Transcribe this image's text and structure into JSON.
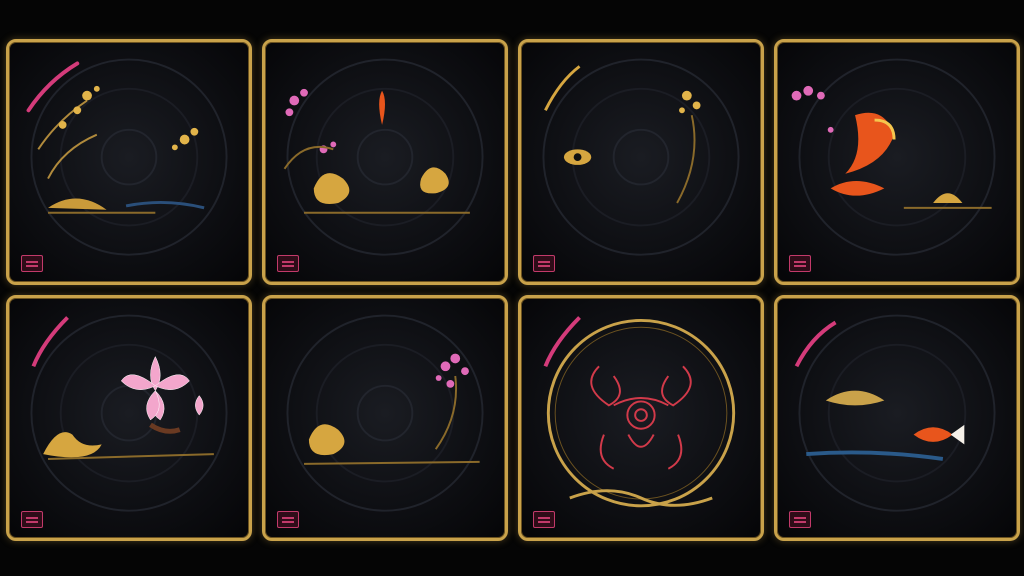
{
  "colors": {
    "background": "#050505",
    "frame_gold": "#c9a24a",
    "ink_dark": "#0e0f13",
    "blossom_pink": "#e06ab8",
    "koi_orange": "#e8551c",
    "seal_red": "#c23a6a"
  },
  "tiles": [
    {
      "motif": "gold-orchid-branches-icon"
    },
    {
      "motif": "pink-blossom-gold-swirl-icon"
    },
    {
      "motif": "gold-eye-branch-icon"
    },
    {
      "motif": "koi-fish-pink-blossom-icon"
    },
    {
      "motif": "pink-lotus-flower-icon"
    },
    {
      "motif": "gold-swirl-pink-blossom-icon"
    },
    {
      "motif": "red-ornamental-crest-icon"
    },
    {
      "motif": "koi-fish-water-icon"
    }
  ]
}
